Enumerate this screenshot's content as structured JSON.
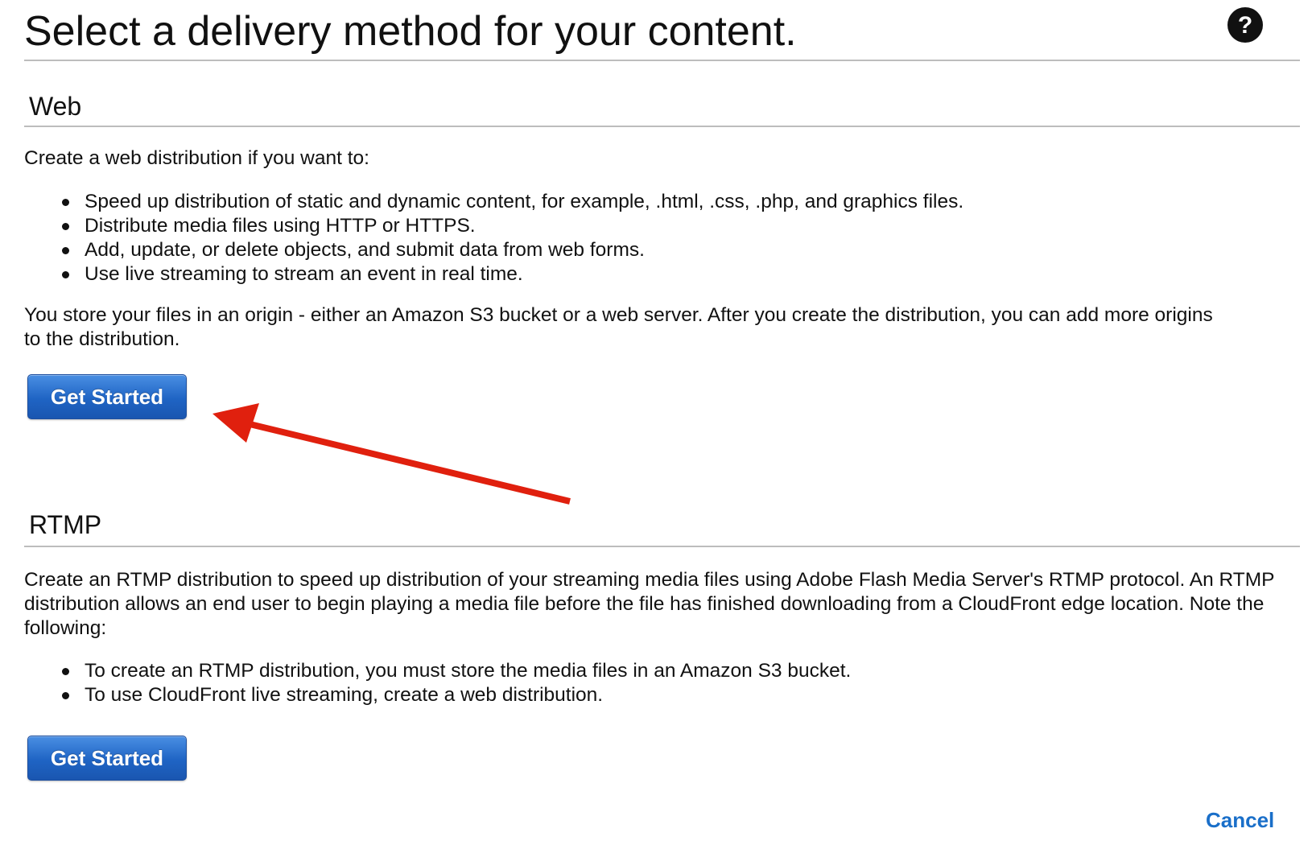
{
  "page": {
    "title": "Select a delivery method for your content.",
    "help_icon": "question-circle-icon"
  },
  "web": {
    "heading": "Web",
    "intro": "Create a web distribution if you want to:",
    "bullets": [
      "Speed up distribution of static and dynamic content, for example, .html, .css, .php, and graphics files.",
      "Distribute media files using HTTP or HTTPS.",
      "Add, update, or delete objects, and submit data from web forms.",
      "Use live streaming to stream an event in real time."
    ],
    "note": "You store your files in an origin - either an Amazon S3 bucket or a web server. After you create the distribution, you can add more origins to the distribution.",
    "button_label": "Get Started"
  },
  "rtmp": {
    "heading": "RTMP",
    "intro": "Create an RTMP distribution to speed up distribution of your streaming media files using Adobe Flash Media Server's RTMP protocol. An RTMP distribution allows an end user to begin playing a media file before the file has finished downloading from a CloudFront edge location. Note the following:",
    "bullets": [
      "To create an RTMP distribution, you must store the media files in an Amazon S3 bucket.",
      "To use CloudFront live streaming, create a web distribution."
    ],
    "button_label": "Get Started"
  },
  "footer": {
    "cancel_label": "Cancel"
  },
  "annotation": {
    "arrow_color": "#e0200e"
  },
  "colors": {
    "button_blue": "#1f64c4",
    "link_blue": "#1a6fc9",
    "rule_gray": "#bdbdbd"
  }
}
